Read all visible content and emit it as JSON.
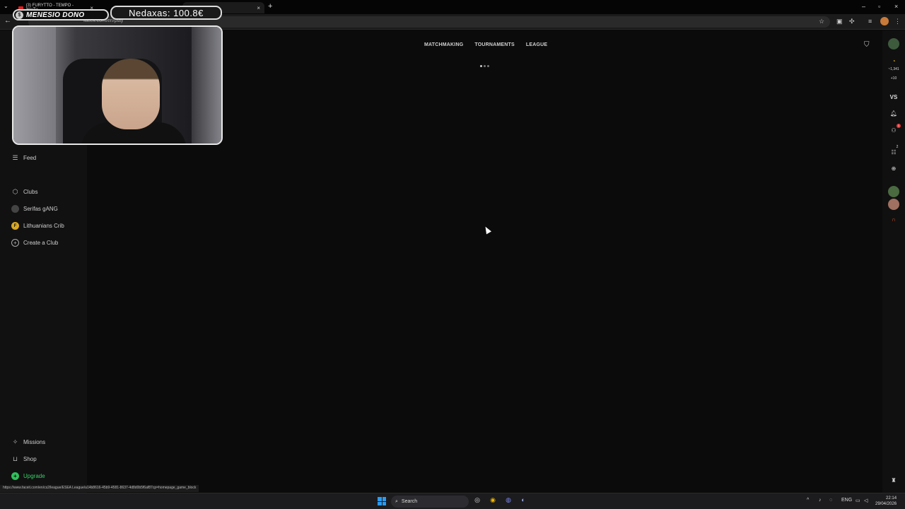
{
  "browser": {
    "tabs": [
      {
        "title": "(3) FURYTTO - TEMPO - YouTu...",
        "icon": "youtube-icon"
      },
      {
        "title": "",
        "icon": "twitch-icon"
      },
      {
        "title": "",
        "icon": "faceit-icon",
        "active": true
      }
    ],
    "url": "faceit.com/en/play",
    "status_url": "https://www.faceit.com/en/cs2/league/ESEA League/a14b8616-45b9-4581-8637-4d8d0b5f6af87cp=homepage_game_block"
  },
  "overlay": {
    "dono_label": "MENESIO DONO",
    "dono_coin": "$",
    "top_donor": "Nedaxas: 100.8€"
  },
  "topnav": {
    "items": [
      "MATCHMAKING",
      "TOURNAMENTS",
      "LEAGUE"
    ]
  },
  "sidebar": {
    "feed": "Feed",
    "clubs_header": "Clubs",
    "clubs": [
      {
        "label": "Serifas gANG",
        "icon": "club-avatar-icon"
      },
      {
        "label": "Lithuanians Crib",
        "icon": "club-avatar-icon",
        "initial": "F"
      }
    ],
    "create_club": "Create a Club",
    "missions": "Missions",
    "shop": "Shop",
    "upgrade": "Upgrade"
  },
  "rightbar": {
    "elo": "~1,341",
    "elo_delta": "+10",
    "vs": "VS",
    "party_badge": "1",
    "queue_badge": "2"
  },
  "taskbar": {
    "search": "Search",
    "lang": "ENG",
    "time": "22:14",
    "date": "29/04/2026"
  }
}
